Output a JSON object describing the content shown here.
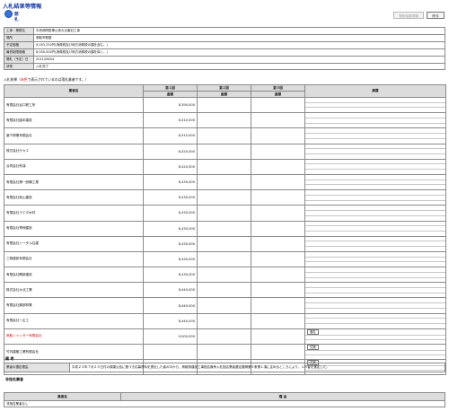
{
  "header": {
    "title": "入札結果等情報",
    "subtab_label": "開札",
    "print_button": "契約結果書類",
    "back_button": "戻る"
  },
  "info": [
    {
      "label": "工事・業務名",
      "value": "中央病院駐車公舎大災害旧工事"
    },
    {
      "label": "場所",
      "value": "鳥取市駅屋"
    },
    {
      "label": "予定価格",
      "value": "9,053,250円(消費税及び地方消費税の額を含む。)"
    },
    {
      "label": "最低制限価格",
      "value": "8,550,000円(消費税及び地方消費税の額を除く。)"
    },
    {
      "label": "開札（予定）日",
      "value": "2011/08/04"
    },
    {
      "label": "状態",
      "value": "入札完了"
    }
  ],
  "notice": {
    "pre": "入札結果（",
    "red": "赤色",
    "post": "で表示されているのは落札業者です。）"
  },
  "results": {
    "col_bidder": "業者名",
    "col_round1": "第１回",
    "col_round2": "第２回",
    "col_round3": "第３回",
    "col_amount": "金額",
    "col_memo": "摘要",
    "rows": [
      {
        "name": "有限会社谷口鉄工所",
        "amount": "8,390,000",
        "memo": "",
        "winner": false
      },
      {
        "name": "有限会社園本建設",
        "amount": "8,410,000",
        "memo": "",
        "winner": false
      },
      {
        "name": "藤千興業有限会社",
        "amount": "8,410,000",
        "memo": "",
        "winner": false
      },
      {
        "name": "株式会社サカエ",
        "amount": "8,420,000",
        "memo": "",
        "winner": false
      },
      {
        "name": "合同会社有漢",
        "amount": "8,420,000",
        "memo": "",
        "winner": false
      },
      {
        "name": "有限会社第一設備工業",
        "amount": "8,430,000",
        "memo": "",
        "winner": false
      },
      {
        "name": "有限会社秋山建設",
        "amount": "8,430,000",
        "memo": "",
        "winner": false
      },
      {
        "name": "有限会社マエダ木材",
        "amount": "8,430,000",
        "memo": "",
        "winner": false
      },
      {
        "name": "有限会社青伸建設",
        "amount": "8,430,000",
        "memo": "",
        "winner": false
      },
      {
        "name": "有限会社トータル住建",
        "amount": "8,430,000",
        "memo": "",
        "winner": false
      },
      {
        "name": "三翔建設有限会社",
        "amount": "8,430,000",
        "memo": "",
        "winner": false
      },
      {
        "name": "有限会社開新建設",
        "amount": "8,430,000",
        "memo": "",
        "winner": false
      },
      {
        "name": "株式会社大北工業",
        "amount": "8,440,000",
        "memo": "",
        "winner": false
      },
      {
        "name": "有限会社秦部林業",
        "amount": "8,440,000",
        "memo": "",
        "winner": false
      },
      {
        "name": "有限会社一企工",
        "amount": "8,440,000",
        "memo": "",
        "winner": false
      },
      {
        "name": "鳥取シャッター有限会社",
        "amount": "9,000,000",
        "memo": "落札",
        "winner": true
      },
      {
        "name": "竹内建築工業有限会社",
        "amount": "",
        "memo": "欠席",
        "winner": false
      },
      {
        "name": "太陽テクノス合同会社",
        "amount": "",
        "memo": "欠席",
        "winner": false
      }
    ]
  },
  "biko": {
    "title": "備 考",
    "label": "業者の選定理由",
    "text": "平成２３年７月２０日付の調達公告に基づき応募資料を提出した者の中から、鳥取県建設工事指名競争入札指名業者選定要綱第５条第１項に定めるところにより、１８者を選定した。"
  },
  "nonpart": {
    "title": "非指名業者",
    "col_name": "業者名",
    "col_reason": "理 由",
    "empty_text": "非指名業者なし"
  }
}
